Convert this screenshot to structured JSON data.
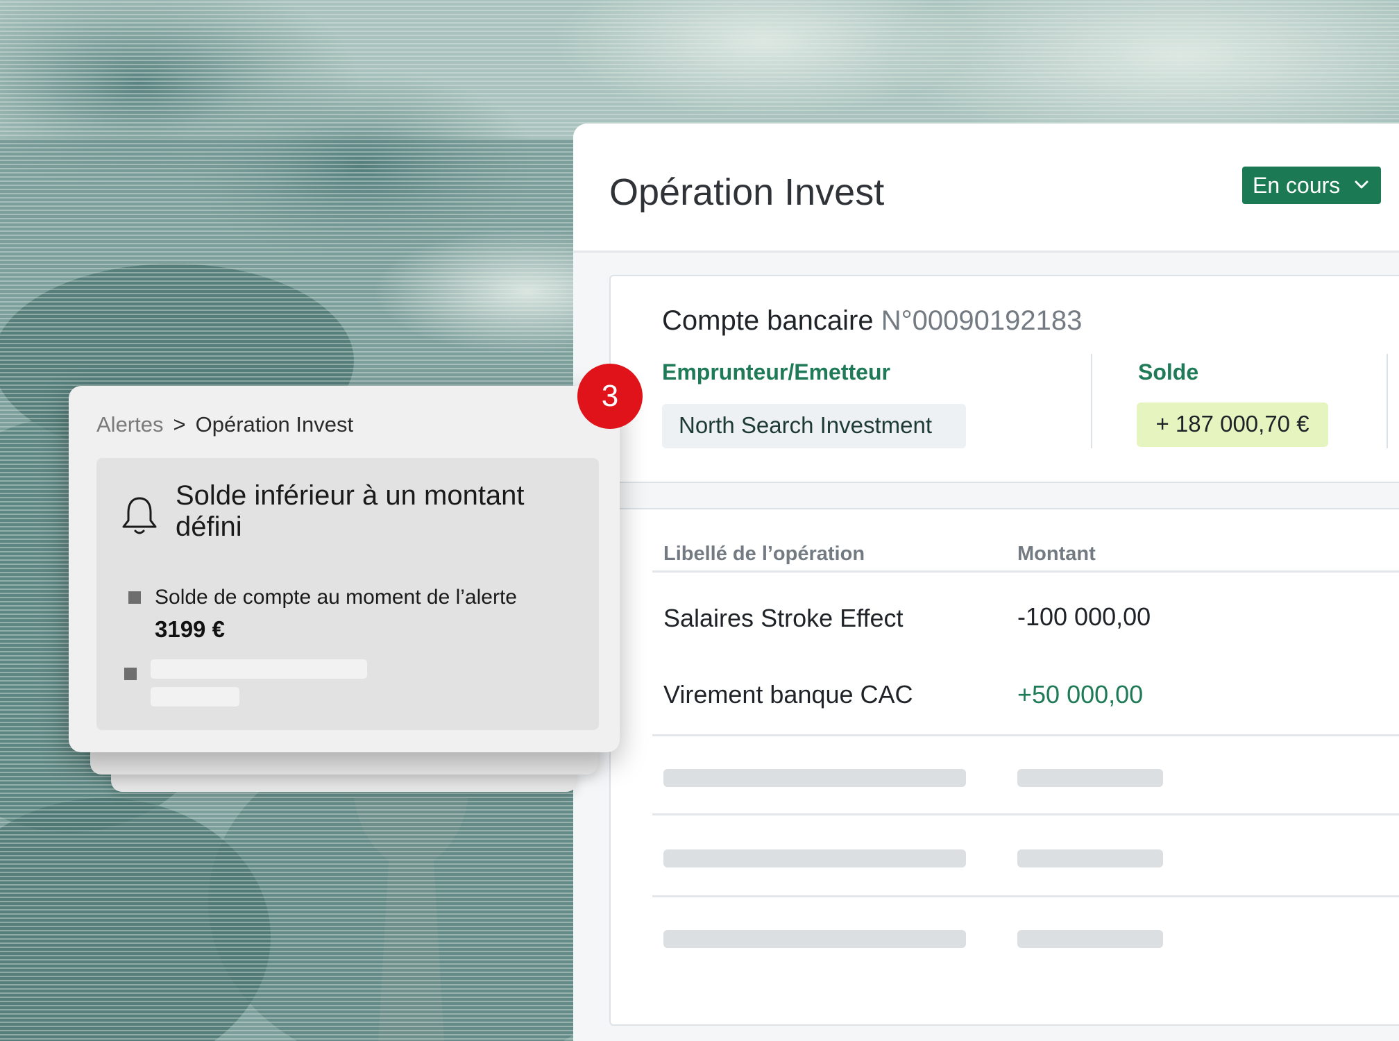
{
  "panel": {
    "title": "Opération Invest",
    "status": {
      "label": "En cours",
      "icon": "chevron-down-icon"
    }
  },
  "account": {
    "title": "Compte bancaire",
    "number": "N°00090192183",
    "borrower_label": "Emprunteur/Emetteur",
    "borrower_value": "North Search Investment",
    "balance_label": "Solde",
    "balance_value": "+ 187 000,70 €"
  },
  "operations": {
    "columns": [
      "Libellé de l’opération",
      "Montant"
    ],
    "rows": [
      {
        "label": "Salaires Stroke Effect",
        "amount": "-100 000,00"
      },
      {
        "label": "Virement banque CAC",
        "amount": "+50 000,00"
      }
    ]
  },
  "alert": {
    "breadcrumb": {
      "parent": "Alertes",
      "separator": ">",
      "current": "Opération Invest"
    },
    "icon": "bell-icon",
    "title": "Solde inférieur à un montant défini",
    "detail_label": "Solde de compte au moment de l’alerte",
    "detail_value": "3199 €"
  },
  "step_badge": "3",
  "colors": {
    "accent_green": "#1b7a53",
    "positive_amount": "#1f7a57",
    "balance_chip": "#e6f4c0",
    "badge_red": "#e1131a",
    "background_engraving": "#7f9f9d"
  }
}
